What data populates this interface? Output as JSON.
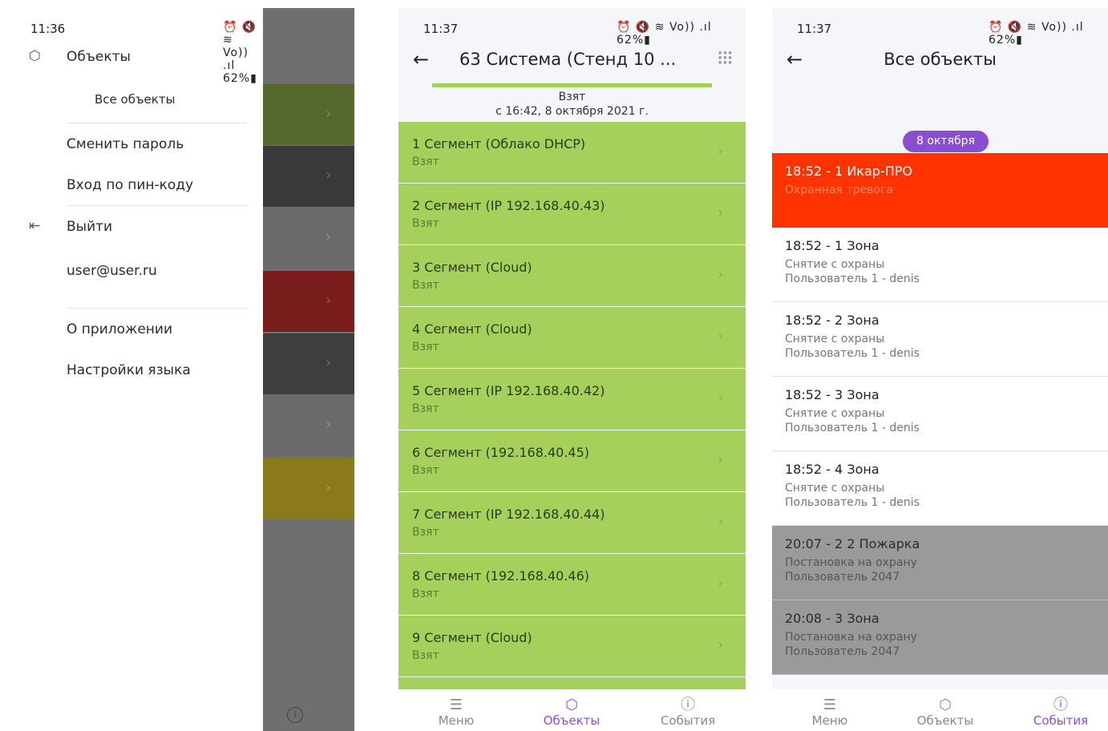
{
  "screen1": {
    "status": {
      "time": "11:36",
      "icons": "⏰ 🔇 ≋ Vo)) .ıl 62%▮"
    },
    "menu": {
      "objects": "Объекты",
      "all_objects": "Все объекты",
      "change_password": "Сменить пароль",
      "pin_login": "Вход по пин-коду",
      "logout": "Выйти",
      "user": "user@user.ru",
      "about": "О приложении",
      "language": "Настройки языка"
    },
    "bg_rows": [
      {
        "color": "#56692d"
      },
      {
        "color": "#3a3a3a"
      },
      {
        "color": "#6a6a6a"
      },
      {
        "color": "#7a1d1d"
      },
      {
        "color": "#3e3e3e"
      },
      {
        "color": "#6a6a6a"
      },
      {
        "color": "#8a7a1c"
      }
    ]
  },
  "screen2": {
    "status": {
      "time": "11:37",
      "icons": "⏰ 🔇 ≋ Vo)) .ıl 62%▮"
    },
    "title": "63 Система (Стенд 10 ...",
    "state": "Взят",
    "since": "с 16:42, 8 октября 2021 г.",
    "segments": [
      {
        "name": "1 Сегмент (Облако DHCP)",
        "state": "Взят"
      },
      {
        "name": "2 Сегмент (IP 192.168.40.43)",
        "state": "Взят"
      },
      {
        "name": "3 Сегмент (Cloud)",
        "state": "Взят"
      },
      {
        "name": "4 Сегмент (Cloud)",
        "state": "Взят"
      },
      {
        "name": "5 Сегмент (IP 192.168.40.42)",
        "state": "Взят"
      },
      {
        "name": "6 Сегмент (192.168.40.45)",
        "state": "Взят"
      },
      {
        "name": "7 Сегмент (IP 192.168.40.44)",
        "state": "Взят"
      },
      {
        "name": "8 Сегмент (192.168.40.46)",
        "state": "Взят"
      },
      {
        "name": "9 Сегмент (Cloud)",
        "state": "Взят"
      }
    ]
  },
  "screen3": {
    "status": {
      "time": "11:37",
      "icons": "⏰ 🔇 ≋ Vo)) .ıl 62%▮"
    },
    "title": "Все объекты",
    "date_badge": "8 октября",
    "events": [
      {
        "title": "18:52 - 1 Икар-ПРО",
        "line1": "Охранная тревога",
        "line2": ""
      },
      {
        "title": "18:52 - 1 Зона",
        "line1": "Снятие с охраны",
        "line2": "Пользователь 1 - denis"
      },
      {
        "title": "18:52 - 2 Зона",
        "line1": "Снятие с охраны",
        "line2": "Пользователь 1 - denis"
      },
      {
        "title": "18:52 - 3 Зона",
        "line1": "Снятие с охраны",
        "line2": "Пользователь 1 - denis"
      },
      {
        "title": "18:52 - 4 Зона",
        "line1": "Снятие с охраны",
        "line2": "Пользователь 1 - denis"
      },
      {
        "title": "20:07 - 2 2 Пожарка",
        "line1": "Постановка на охрану",
        "line2": "Пользователь 2047"
      },
      {
        "title": "20:08 - 3 Зона",
        "line1": "Постановка на охрану",
        "line2": "Пользователь 2047"
      }
    ]
  },
  "nav": {
    "menu": "Меню",
    "objects": "Объекты",
    "events": "События"
  },
  "colors": {
    "accent": "#8a4fd0",
    "segment_green": "#a6d05c",
    "alarm_red": "#ff3300",
    "grey_event": "#9a9a9a"
  }
}
